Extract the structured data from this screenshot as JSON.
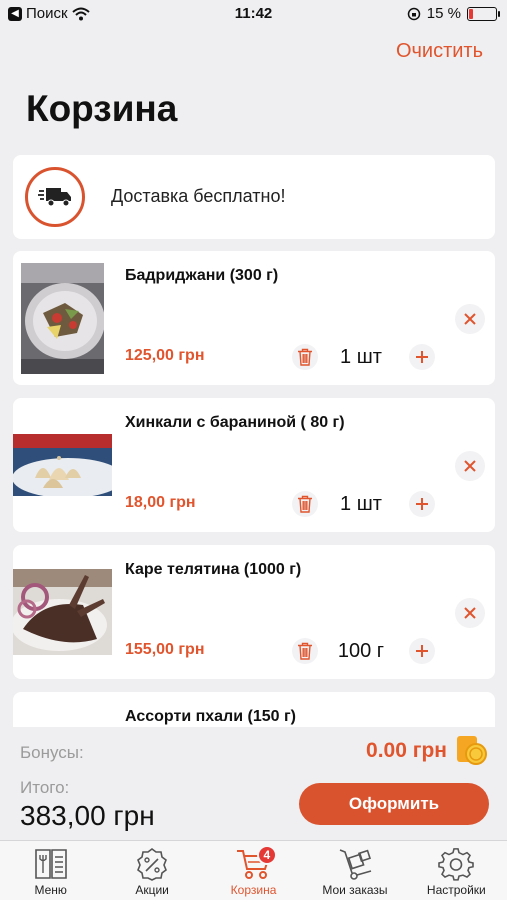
{
  "status_bar": {
    "carrier": "Поиск",
    "time": "11:42",
    "battery_percent": "15 %",
    "battery_level": 0.15
  },
  "header": {
    "clear_label": "Очистить",
    "title": "Корзина"
  },
  "delivery": {
    "text": "Доставка бесплатно!",
    "icon": "truck-icon"
  },
  "items": [
    {
      "name": "Бадриджани (300 г)",
      "price": "125,00 грн",
      "qty": "1 шт"
    },
    {
      "name": "Хинкали с бараниной ( 80 г)",
      "price": "18,00 грн",
      "qty": "1 шт"
    },
    {
      "name": "Каре телятина (1000 г)",
      "price": "155,00 грн",
      "qty": "100 г"
    },
    {
      "name": "Ассорти пхали  (150 г)"
    }
  ],
  "summary": {
    "bonus_label": "Бонусы:",
    "bonus_value": "0.00 грн",
    "total_label": "Итого:",
    "total_value": "383,00 грн",
    "checkout_label": "Оформить"
  },
  "tabs": [
    {
      "label": "Меню",
      "icon": "menu-book-icon"
    },
    {
      "label": "Акции",
      "icon": "discount-icon"
    },
    {
      "label": "Корзина",
      "icon": "cart-icon",
      "badge": "4",
      "active": true
    },
    {
      "label": "Мои заказы",
      "icon": "hand-truck-icon"
    },
    {
      "label": "Настройки",
      "icon": "gear-icon"
    }
  ],
  "colors": {
    "accent": "#d9532f",
    "accent_text": "#e0552e",
    "background": "#efeff1",
    "badge": "#e53935"
  }
}
